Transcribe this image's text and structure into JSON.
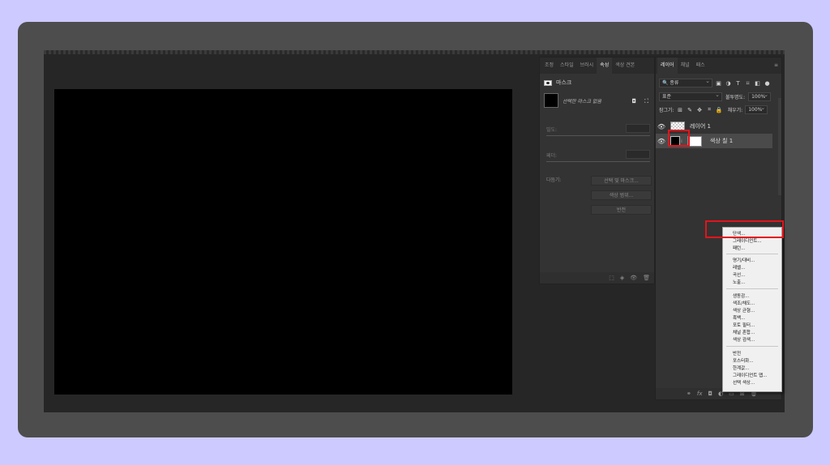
{
  "properties": {
    "tabs": [
      "조정",
      "스타일",
      "브러시",
      "속성",
      "색상 견본"
    ],
    "active_tab": "속성",
    "section_title": "마스크",
    "mask_status": "선택한 마스크 없음",
    "density_label": "밀도:",
    "feather_label": "페더:",
    "refine_label": "다듬기:",
    "buttons": [
      "선택 및 마스크...",
      "색상 범위...",
      "반전"
    ]
  },
  "layers": {
    "tabs": [
      "레이어",
      "채널",
      "패스"
    ],
    "active_tab": "레이어",
    "kind_filter": "종류",
    "blend_mode": "표준",
    "opacity_label": "불투명도:",
    "opacity_value": "100%",
    "lock_label": "잠그기:",
    "fill_label": "채우기:",
    "fill_value": "100%",
    "items": [
      {
        "name": "레이어 1",
        "visible": true,
        "selected": false
      },
      {
        "name": "색상 칠 1",
        "visible": true,
        "selected": true
      }
    ],
    "bottom_icons": [
      "link-icon",
      "fx-icon",
      "mask-icon",
      "adjustment-icon",
      "folder-icon",
      "new-layer-icon",
      "trash-icon"
    ]
  },
  "context_menu": {
    "groups": [
      [
        "단색...",
        "그레이디언트...",
        "패턴..."
      ],
      [
        "명기/대비...",
        "레벨...",
        "곡선...",
        "노출..."
      ],
      [
        "생동감...",
        "색조/채도...",
        "색상 균형...",
        "흑백...",
        "포토 필터...",
        "채널 혼합...",
        "색상 검색..."
      ],
      [
        "반전",
        "포스터화...",
        "한계값...",
        "그레이디언트 맵...",
        "선택 색상..."
      ]
    ]
  },
  "colors": {
    "background": "#cdcaff",
    "frame": "#4d4d4d",
    "panel": "#333333",
    "highlight": "#e3141b"
  }
}
